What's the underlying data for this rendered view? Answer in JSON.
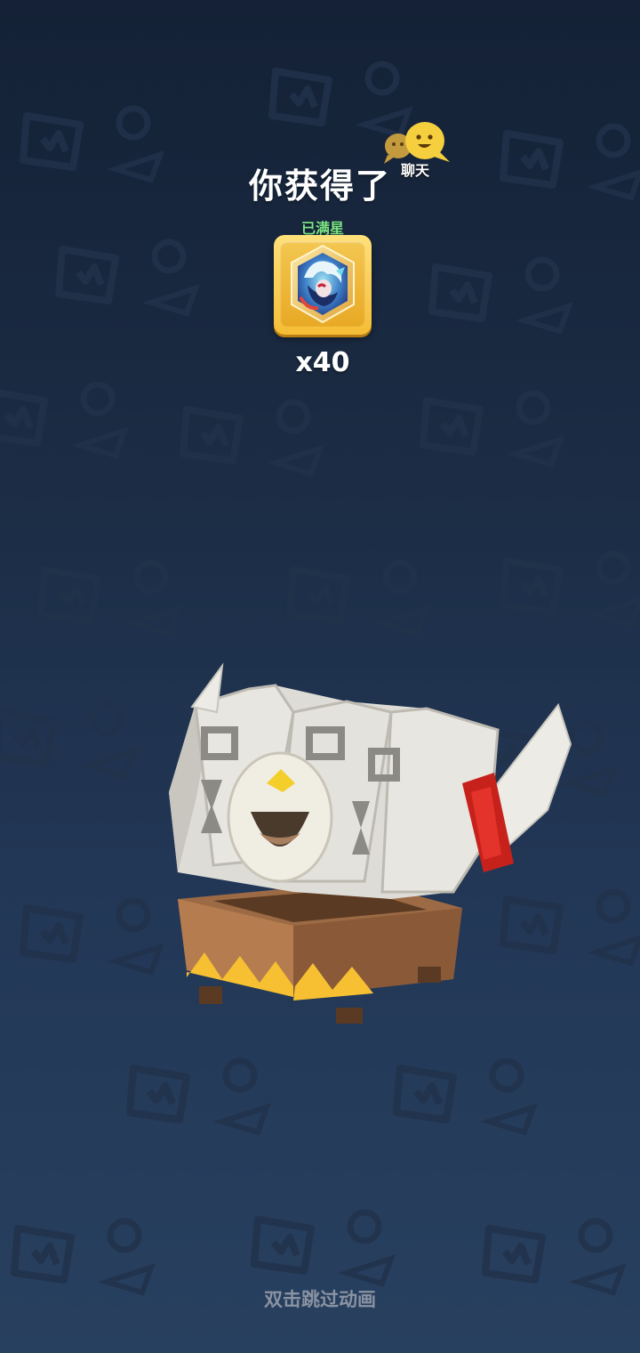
{
  "title": "你获得了",
  "chat": {
    "label": "聊天",
    "icon": "chat-bubbles-icon"
  },
  "reward": {
    "status_label": "已满星",
    "count_label": "x40",
    "icon": "character-shard-icon"
  },
  "chest": {
    "icon": "treasure-chest-icon"
  },
  "skip_hint": "双击跳过动画",
  "colors": {
    "background_top": "#142136",
    "background_bottom": "#28405f",
    "status_green": "#7be585",
    "card_gold": "#f5bd35",
    "hint_gray": "#8a93a2"
  }
}
